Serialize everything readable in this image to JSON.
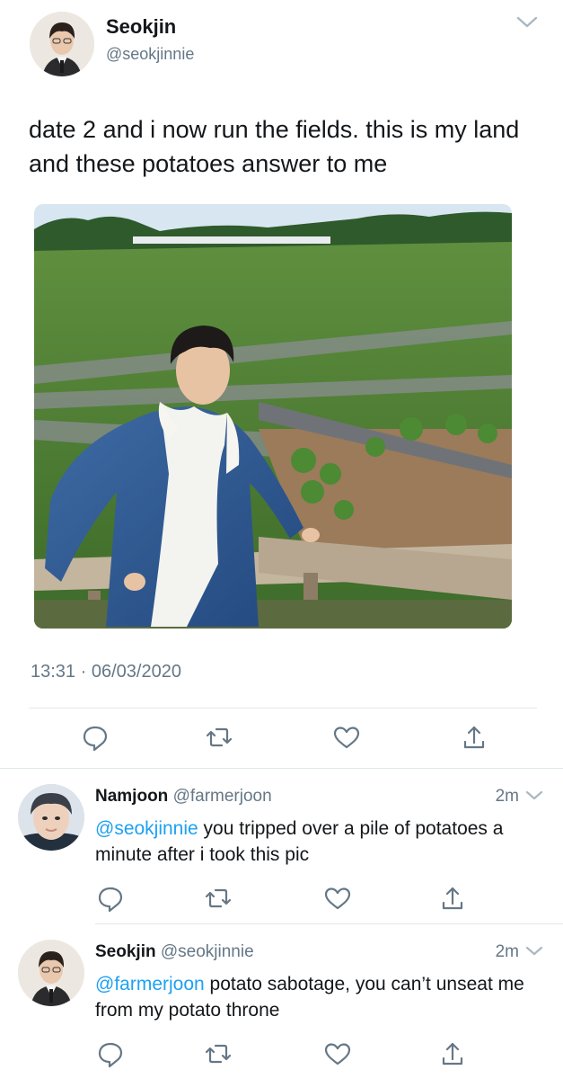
{
  "main_tweet": {
    "author_name": "Seokjin",
    "author_handle": "@seokjinnie",
    "text": "date 2 and i now run the fields. this is my land and these potatoes answer to me",
    "time": "13:31",
    "separator": "·",
    "date": "06/03/2020",
    "photo_description_icon": "photo-field"
  },
  "replies": [
    {
      "author_name": "Namjoon",
      "author_handle": "@farmerjoon",
      "age": "2m",
      "mention": "@seokjinnie",
      "text": " you tripped over a pile of potatoes a minute after i took this pic"
    },
    {
      "author_name": "Seokjin",
      "author_handle": "@seokjinnie",
      "age": "2m",
      "mention": "@farmerjoon",
      "text": " potato sabotage, you can’t unseat me from my potato throne"
    }
  ],
  "icons": {
    "reply": "reply-icon",
    "retweet": "retweet-icon",
    "like": "like-icon",
    "share": "share-icon",
    "more": "chevron-down-icon"
  },
  "colors": {
    "text": "#14171a",
    "secondary": "#657786",
    "link": "#1da1f2",
    "divider": "#e1e8ed"
  }
}
